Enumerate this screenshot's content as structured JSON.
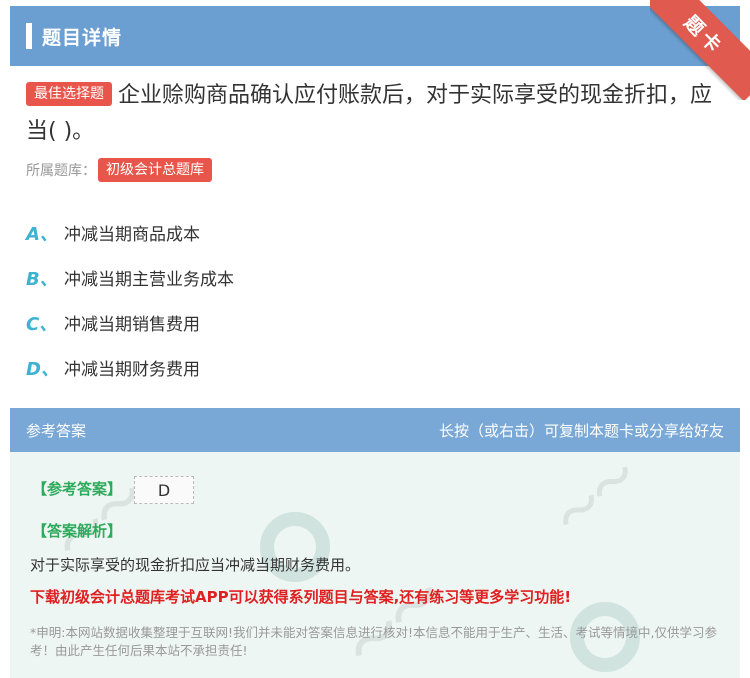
{
  "header": {
    "title": "题目详情"
  },
  "corner_badge": "题卡",
  "question": {
    "tag": "最佳选择题",
    "text": "企业赊购商品确认应付账款后，对于实际享受的现金折扣，应当( )。"
  },
  "bank": {
    "label": "所属题库：",
    "name": "初级会计总题库"
  },
  "options": [
    {
      "letter": "A、",
      "text": "冲减当期商品成本"
    },
    {
      "letter": "B、",
      "text": "冲减当期主营业务成本"
    },
    {
      "letter": "C、",
      "text": "冲减当期销售费用"
    },
    {
      "letter": "D、",
      "text": "冲减当期财务费用"
    }
  ],
  "answer_bar": {
    "left": "参考答案",
    "right": "长按（或右击）可复制本题卡或分享给好友"
  },
  "answer": {
    "label": "【参考答案】",
    "value": "D",
    "analysis_label": "【答案解析】",
    "analysis_text": "对于实际享受的现金折扣应当冲减当期财务费用。",
    "promo": "下载初级会计总题库考试APP可以获得系列题目与答案,还有练习等更多学习功能!",
    "disclaimer": "*申明:本网站数据收集整理于互联网!我们并未能对答案信息进行核对!本信息不能用于生产、生活、考试等情境中,仅供学习参考！由此产生任何后果本站不承担责任!"
  },
  "colors": {
    "header": "#6b9fd1",
    "answer_bar": "#7aa8d6",
    "tag": "#e8564b",
    "option_letter": "#3db3d1",
    "answer_label": "#2eaa5c",
    "promo": "#e02020"
  }
}
